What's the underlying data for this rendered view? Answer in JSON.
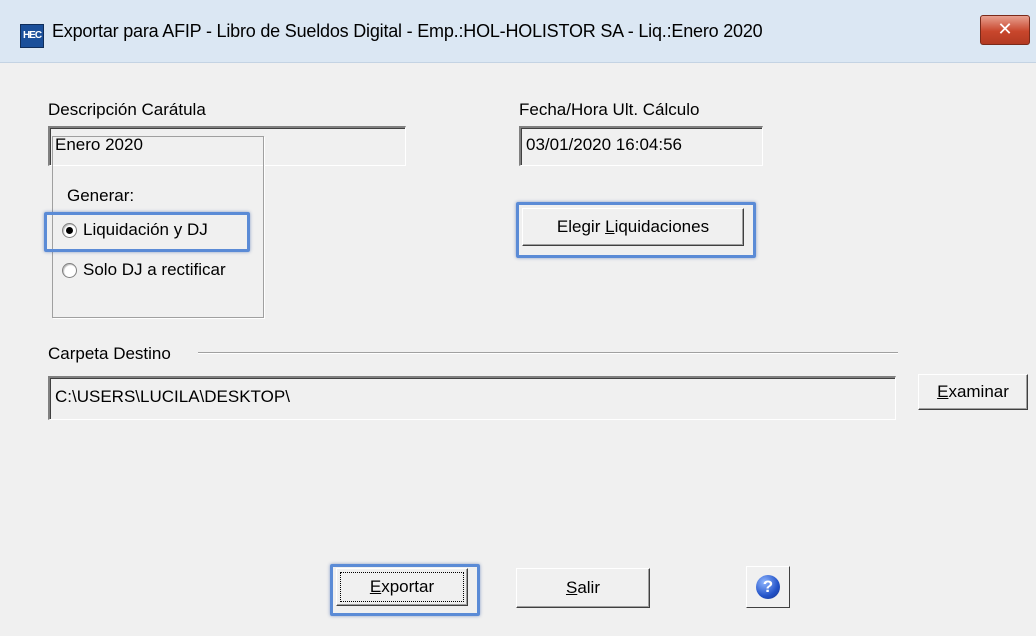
{
  "window": {
    "app_icon_text": "HEC",
    "title": "Exportar para AFIP - Libro de Sueldos Digital - Emp.:HOL-HOLISTOR SA - Liq.:Enero 2020",
    "close_glyph": "✕"
  },
  "form": {
    "descripcion_label": "Descripción Carátula",
    "descripcion_value": "Enero 2020",
    "fecha_label": "Fecha/Hora Ult. Cálculo",
    "fecha_value": "03/01/2020 16:04:56",
    "generar_label": "Generar:",
    "radio_options": [
      {
        "label": "Liquidación y DJ",
        "selected": true
      },
      {
        "label": "Solo DJ a rectificar",
        "selected": false
      }
    ],
    "elegir_button_pre": "Elegir ",
    "elegir_button_accel": "L",
    "elegir_button_post": "iquidaciones",
    "carpeta_label": "Carpeta Destino",
    "carpeta_value": "C:\\USERS\\LUCILA\\DESKTOP\\",
    "examinar_accel": "E",
    "examinar_post": "xaminar"
  },
  "footer": {
    "exportar_accel": "E",
    "exportar_post": "xportar",
    "salir_accel": "S",
    "salir_post": "alir",
    "help_glyph": "?"
  },
  "colors": {
    "highlight": "#5b8bd6",
    "close_button": "#c8462c",
    "help_icon": "#2353c8"
  },
  "icons": [
    "app-logo-icon",
    "close-icon",
    "help-icon"
  ]
}
